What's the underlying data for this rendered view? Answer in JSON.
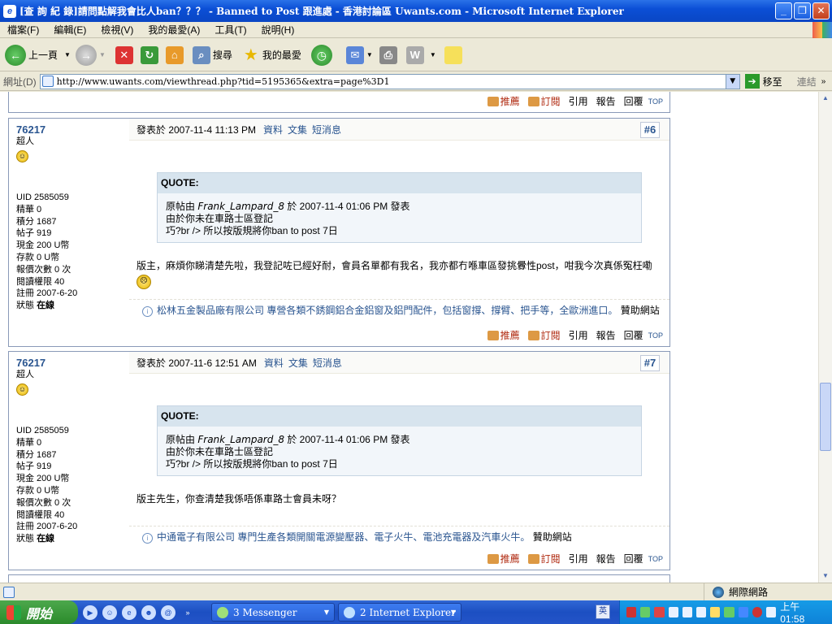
{
  "window": {
    "title": "[查 詢 紀 錄]請問點解我會比人ban？？？ - Banned to Post 跟進處 - 香港討論區 Uwants.com - Microsoft Internet Explorer",
    "minimize": "_",
    "restore": "❐",
    "close": "✕"
  },
  "menu": [
    "檔案(F)",
    "編輯(E)",
    "檢視(V)",
    "我的最愛(A)",
    "工具(T)",
    "說明(H)"
  ],
  "toolbar": {
    "back_label": "上一頁",
    "search_label": "搜尋",
    "favorites_label": "我的最愛"
  },
  "address": {
    "label": "網址(D)",
    "url": "http://www.uwants.com/viewthread.php?tid=5195365&extra=page%3D1",
    "go_label": "移至",
    "links_label": "連結"
  },
  "actions": {
    "recommend": "推薦",
    "subscribe": "訂閱",
    "quote": "引用",
    "report": "報告",
    "reply": "回覆",
    "top": "TOP"
  },
  "posts": [
    {
      "username": "76217",
      "rank": "超人",
      "uid": "UID 2585059",
      "elite": "精華 0",
      "points": "積分 1687",
      "posts": "帖子 919",
      "cash": "現金 200 U幣",
      "deposit": "存款 0 U幣",
      "reports": "報價次數 0 次",
      "read_perm": "閱讀權限 40",
      "registered": "註冊 2007-6-20",
      "status_label": "狀態",
      "status": "在線",
      "posted_at": "發表於 2007-11-4 11:13 PM",
      "links": [
        "資料",
        "文集",
        "短消息"
      ],
      "number": "#6",
      "quote_title": "QUOTE:",
      "quote_prefix": "原帖由",
      "quote_author": "Frank_Lampard_8",
      "quote_suffix": "於 2007-11-4 01:06 PM 發表",
      "quote_line2": "由於你未在車路士區登記",
      "quote_line3": "巧?br /> 所以按版規將你ban to post 7日",
      "message": "版主，麻煩你睇清楚先啦，我登記咗已經好耐，會員名單都有我名，我亦都冇喺車區發挑釁性post，咁我今次真係冤枉嘞",
      "ad_company": "松林五金製品廠有限公司 專營各類不銹鋼鋁合金鋁窗及鋁門配件，包括窗撐、撐臂、把手等，全歐洲進口。",
      "ad_tail": "贊助網站"
    },
    {
      "username": "76217",
      "rank": "超人",
      "uid": "UID 2585059",
      "elite": "精華 0",
      "points": "積分 1687",
      "posts": "帖子 919",
      "cash": "現金 200 U幣",
      "deposit": "存款 0 U幣",
      "reports": "報價次數 0 次",
      "read_perm": "閱讀權限 40",
      "registered": "註冊 2007-6-20",
      "status_label": "狀態",
      "status": "在線",
      "posted_at": "發表於 2007-11-6 12:51 AM",
      "links": [
        "資料",
        "文集",
        "短消息"
      ],
      "number": "#7",
      "quote_title": "QUOTE:",
      "quote_prefix": "原帖由",
      "quote_author": "Frank_Lampard_8",
      "quote_suffix": "於 2007-11-4 01:06 PM 發表",
      "quote_line2": "由於你未在車路士區登記",
      "quote_line3": "巧?br /> 所以按版規將你ban to post 7日",
      "message": "版主先生，你查清楚我係唔係車路士會員未呀？",
      "ad_company": "中通電子有限公司 專門生產各類開關電源變壓器、電子火牛、電池充電器及汽車火牛。",
      "ad_tail": "贊助網站"
    }
  ],
  "status_bar": {
    "zone": "網際網路"
  },
  "taskbar": {
    "start": "開始",
    "tasks": [
      "3 Messenger",
      "2 Internet Explorer"
    ],
    "lang": "英",
    "clock": "上午 01:58"
  }
}
